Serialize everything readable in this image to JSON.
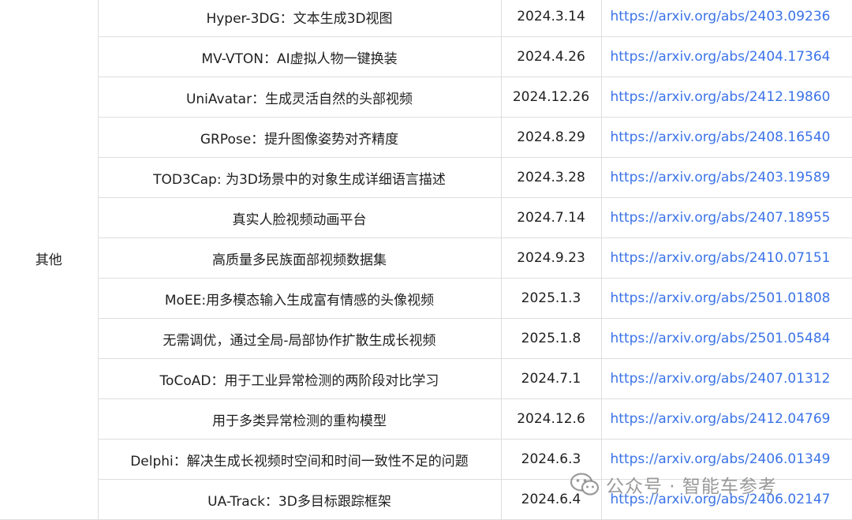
{
  "category": "其他",
  "rows": [
    {
      "title": "Hyper-3DG：文本生成3D视图",
      "date": "2024.3.14",
      "link": "https://arxiv.org/abs/2403.09236"
    },
    {
      "title": "MV-VTON：AI虚拟人物一键换装",
      "date": "2024.4.26",
      "link": "https://arxiv.org/abs/2404.17364"
    },
    {
      "title": "UniAvatar：生成灵活自然的头部视频",
      "date": "2024.12.26",
      "link": "https://arxiv.org/abs/2412.19860"
    },
    {
      "title": "GRPose：提升图像姿势对齐精度",
      "date": "2024.8.29",
      "link": "https://arxiv.org/abs/2408.16540"
    },
    {
      "title": "TOD3Cap: 为3D场景中的对象生成详细语言描述",
      "date": "2024.3.28",
      "link": "https://arxiv.org/abs/2403.19589"
    },
    {
      "title": "真实人脸视频动画平台",
      "date": "2024.7.14",
      "link": "https://arxiv.org/abs/2407.18955"
    },
    {
      "title": "高质量多民族面部视频数据集",
      "date": "2024.9.23",
      "link": "https://arxiv.org/abs/2410.07151"
    },
    {
      "title": "MoEE:用多模态输入生成富有情感的头像视频",
      "date": "2025.1.3",
      "link": "https://arxiv.org/abs/2501.01808"
    },
    {
      "title": "无需调优，通过全局-局部协作扩散生成长视频",
      "date": "2025.1.8",
      "link": "https://arxiv.org/abs/2501.05484"
    },
    {
      "title": "ToCoAD：用于工业异常检测的两阶段对比学习",
      "date": "2024.7.1",
      "link": "https://arxiv.org/abs/2407.01312"
    },
    {
      "title": "用于多类异常检测的重构模型",
      "date": "2024.12.6",
      "link": "https://arxiv.org/abs/2412.04769"
    },
    {
      "title": "Delphi：解决生成长视频时空间和时间一致性不足的问题",
      "date": "2024.6.3",
      "link": "https://arxiv.org/abs/2406.01349"
    },
    {
      "title": "UA-Track：3D多目标跟踪框架",
      "date": "2024.6.4",
      "link": "https://arxiv.org/abs/2406.02147"
    }
  ],
  "watermark": "公众号 · 智能车参考",
  "colors": {
    "link": "#3b73e8",
    "border": "#dedede",
    "text": "#1f1f1f"
  }
}
